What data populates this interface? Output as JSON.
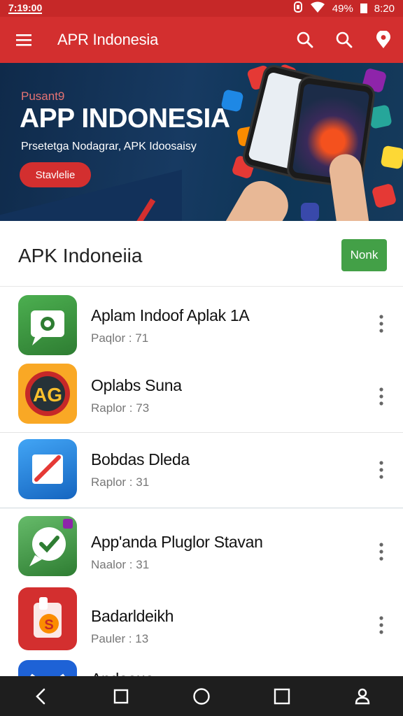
{
  "status_bar": {
    "left_time": "7:19:00",
    "battery_percent": "49%",
    "time": "8:20"
  },
  "app_bar": {
    "title": "APR Indonesia",
    "icons": [
      "menu-icon",
      "search-icon",
      "search-icon",
      "location-pin-icon"
    ]
  },
  "banner": {
    "kicker": "Pusant9",
    "headline": "APP INDONESIA",
    "subtitle": "Prsetetga Nodagrar, APK Idoosaisy",
    "cta_label": "Stavlelie"
  },
  "section": {
    "heading": "APK Indoneiia",
    "button_label": "Nonk"
  },
  "apps": [
    {
      "name": "Aplam Indoof Aplak 1A",
      "meta": "Paqlor : 71",
      "icon": "chat-bubble-icon"
    },
    {
      "name": "Oplabs Suna",
      "meta": "Raplor : 73",
      "icon": "ag-logo-icon"
    },
    {
      "name": "Bobdas Dleda",
      "meta": "Raplor : 31",
      "icon": "edit-note-icon"
    },
    {
      "name": "App'anda Pluglor Stavan",
      "meta": "Naalor : 31",
      "icon": "message-check-icon"
    },
    {
      "name": "Badarldeikh",
      "meta": "Pauler : 13",
      "icon": "shopping-bag-icon"
    },
    {
      "name": "Andaaua",
      "meta": "",
      "icon": "mail-icon"
    }
  ],
  "colors": {
    "primary": "#d32f2f",
    "status_bar": "#c62828",
    "accent_green": "#43a047",
    "banner_bg": "#173a62",
    "nav_bar": "#1e1e1e"
  },
  "nav": [
    "back-icon",
    "square-icon",
    "home-circle-icon",
    "recents-square-icon",
    "profile-icon"
  ]
}
